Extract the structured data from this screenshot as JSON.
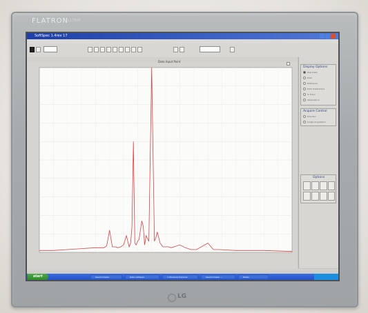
{
  "monitor": {
    "brand": "FLATRON",
    "brand_sub": "L1750P",
    "maker": "LG"
  },
  "window": {
    "title": "SoftSpec 1.4rev 17"
  },
  "graph": {
    "title": "Data Input Point"
  },
  "right_panel": {
    "display_options_title": "Display Options",
    "display_options": [
      "Raw Data",
      "Dark",
      "Reference",
      "Dark Subtracted",
      "% Trans",
      "Absorbance"
    ],
    "acquire_control_title": "Acquire Control",
    "acquire_options": [
      "Free Run",
      "Single Acquisition"
    ],
    "options_title": "Options"
  },
  "taskbar": {
    "start_label": "start",
    "tasks": [
      "Spectrometer",
      "Data software",
      "3 Windows Explorer",
      "Spectrometer ...",
      "Notes"
    ]
  },
  "colors": {
    "spectrum": "#d64242",
    "screen_bg": "#cfcdc9",
    "bezel": "#a7abad",
    "titlebar": "#1d3fa8",
    "taskbar": "#2451c6",
    "start": "#2e8a2b"
  },
  "chart_data": {
    "type": "line",
    "xlim": [
      200,
      1100
    ],
    "ylim": [
      0,
      100
    ],
    "series": [
      {
        "x": [
          200,
          250,
          300,
          350,
          400,
          430,
          440,
          450,
          460,
          470,
          480,
          490,
          500,
          510,
          520,
          525,
          530,
          535,
          540,
          545,
          550,
          555,
          560,
          565,
          570,
          575,
          580,
          590,
          600,
          610,
          615,
          620,
          630,
          640,
          650,
          660,
          670,
          700,
          720,
          740,
          760,
          800,
          820,
          840,
          900,
          1000,
          1100
        ],
        "y": [
          1,
          1,
          1.5,
          2,
          2.5,
          2.5,
          3.5,
          12,
          3,
          3,
          2.5,
          3,
          4,
          9,
          3,
          5,
          14,
          60,
          5,
          4,
          6,
          7,
          12,
          17,
          14,
          4,
          9,
          6,
          100,
          6,
          8,
          11,
          5,
          3,
          3,
          3,
          2.5,
          4,
          2.5,
          1.5,
          1.5,
          5,
          1.5,
          1.5,
          1,
          1,
          0.5
        ]
      }
    ]
  }
}
